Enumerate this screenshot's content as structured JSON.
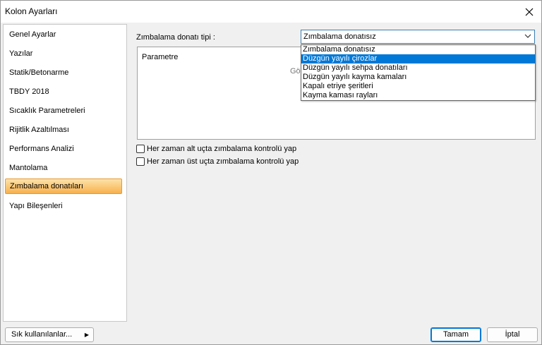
{
  "window": {
    "title": "Kolon Ayarları"
  },
  "sidebar": {
    "items": [
      {
        "label": "Genel Ayarlar"
      },
      {
        "label": "Yazılar"
      },
      {
        "label": "Statik/Betonarme"
      },
      {
        "label": "TBDY 2018"
      },
      {
        "label": "Sıcaklık Parametreleri"
      },
      {
        "label": "Rijitlik Azaltılması"
      },
      {
        "label": "Performans Analizi"
      },
      {
        "label": "Mantolama"
      },
      {
        "label": "Zımbalama donatıları"
      },
      {
        "label": "Yapı Bileşenleri"
      }
    ],
    "selected_index": 8
  },
  "form": {
    "type_label": "Zımbalama donatı tipi :",
    "type_value": "Zımbalama donatısız",
    "param_header": "Parametre",
    "param_hint": "Gö",
    "options": [
      "Zımbalama donatısız",
      "Düzgün yayılı çirozlar",
      "Düzgün yayılı sehpa donatıları",
      "Düzgün yayılı kayma kamaları",
      "Kapalı etriye şeritleri",
      "Kayma kaması rayları"
    ],
    "highlighted_option_index": 1,
    "check_bottom": "Her zaman alt uçta zımbalama kontrolü yap",
    "check_top": "Her zaman üst uçta zımbalama kontrolü yap"
  },
  "footer": {
    "favorites": "Sık kullanılanlar...",
    "ok": "Tamam",
    "cancel": "İptal"
  },
  "colors": {
    "selection_gradient": [
      "#fde3a8",
      "#f8b04e"
    ],
    "highlight": "#0078d7"
  }
}
